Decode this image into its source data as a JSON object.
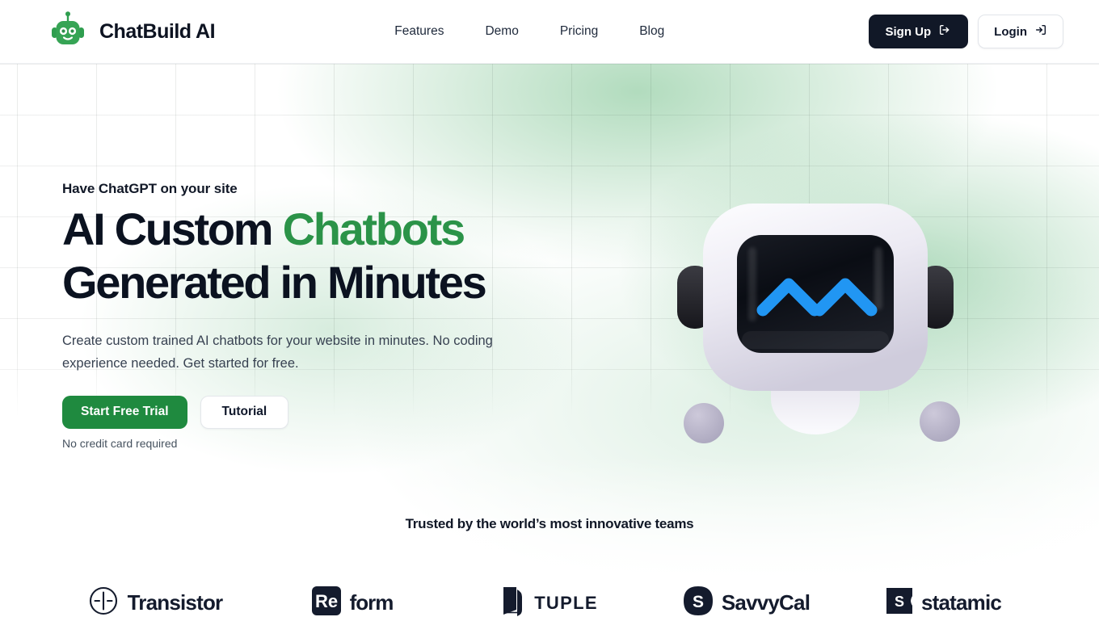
{
  "header": {
    "brand": {
      "name": "ChatBuild AI",
      "logo_icon": "robot-head-icon",
      "color": "#2f9e4f"
    },
    "nav": [
      {
        "label": "Features"
      },
      {
        "label": "Demo"
      },
      {
        "label": "Pricing"
      },
      {
        "label": "Blog"
      }
    ],
    "signup": {
      "label": "Sign Up",
      "icon": "logout-arrow-icon",
      "bg": "#111827"
    },
    "login": {
      "label": "Login",
      "icon": "login-arrow-icon"
    }
  },
  "hero": {
    "eyebrow": "Have ChatGPT on your site",
    "title_line1_plain": "AI Custom ",
    "title_line1_accent": "Chatbots",
    "title_line2": "Generated in Minutes",
    "accent_color": "#2b9348",
    "subtitle": "Create custom trained AI chatbots for your website in minutes. No coding experience needed. Get started for free.",
    "primary_cta": {
      "label": "Start Free Trial",
      "bg": "#1f8a3f"
    },
    "secondary_cta": {
      "label": "Tutorial"
    },
    "note": "No credit card required",
    "illustration": {
      "name": "robot-mascot-illustration",
      "face_color": "#0b0f16",
      "eye_color": "#2196f3",
      "body_color": "#e9e9f0"
    }
  },
  "trusted": {
    "title": "Trusted by the world’s most innovative teams",
    "logos": [
      {
        "name": "Transistor",
        "icon": "transistor-circle-icon"
      },
      {
        "name": "Reform",
        "mark_text": "Re",
        "word": "form",
        "icon": "reform-square-icon"
      },
      {
        "name": "TUPLE",
        "icon": "tuple-book-icon"
      },
      {
        "name": "SavvyCal",
        "mark_text": "S",
        "icon": "savvycal-squircle-icon"
      },
      {
        "name": "statamic",
        "mark_text": "S",
        "icon": "statamic-badge-icon"
      }
    ]
  }
}
